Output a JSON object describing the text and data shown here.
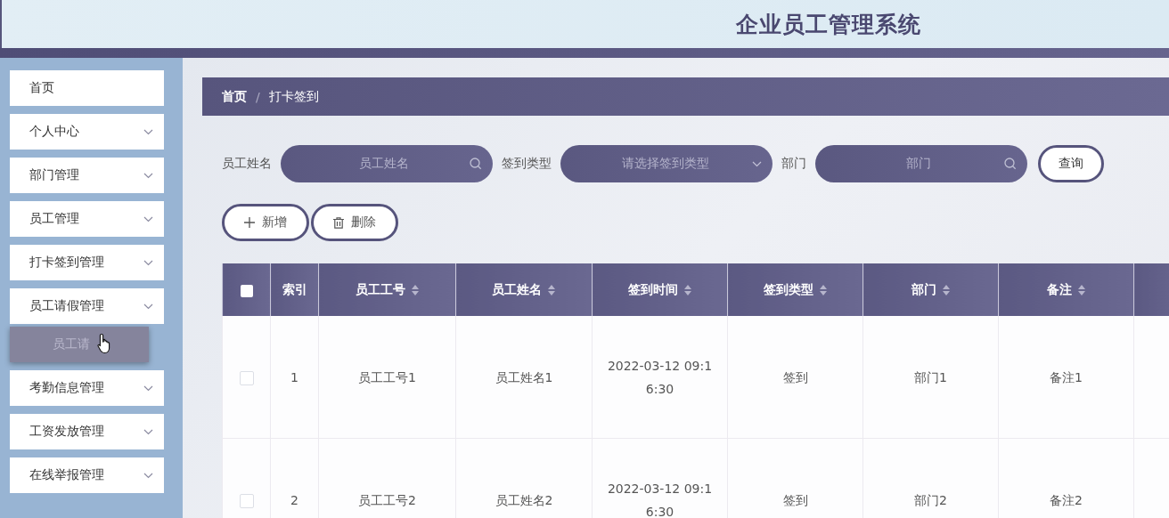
{
  "header": {
    "title": "企业员工管理系统"
  },
  "sidebar": {
    "items": [
      {
        "label": "首页",
        "expandable": false
      },
      {
        "label": "个人中心",
        "expandable": true
      },
      {
        "label": "部门管理",
        "expandable": true
      },
      {
        "label": "员工管理",
        "expandable": true
      },
      {
        "label": "打卡签到管理",
        "expandable": true
      },
      {
        "label": "员工请假管理",
        "expandable": true,
        "children": [
          {
            "label": "员工请",
            "hovered": true
          }
        ]
      },
      {
        "label": "考勤信息管理",
        "expandable": true
      },
      {
        "label": "工资发放管理",
        "expandable": true
      },
      {
        "label": "在线举报管理",
        "expandable": true
      }
    ]
  },
  "breadcrumb": {
    "items": [
      "首页",
      "打卡签到"
    ],
    "separator": "/"
  },
  "search": {
    "fields": [
      {
        "label": "员工姓名",
        "placeholder": "员工姓名",
        "kind": "search"
      },
      {
        "label": "签到类型",
        "placeholder": "请选择签到类型",
        "kind": "select"
      },
      {
        "label": "部门",
        "placeholder": "部门",
        "kind": "search"
      }
    ],
    "button": "查询"
  },
  "actions": [
    {
      "label": "新增",
      "kind": "add"
    },
    {
      "label": "删除",
      "kind": "delete"
    }
  ],
  "table": {
    "columns": [
      {
        "kind": "checkbox",
        "checked": false
      },
      {
        "kind": "text",
        "label": "索引",
        "sortable": false
      },
      {
        "kind": "text",
        "label": "员工工号",
        "sortable": true
      },
      {
        "kind": "text",
        "label": "员工姓名",
        "sortable": true
      },
      {
        "kind": "text",
        "label": "签到时间",
        "sortable": true
      },
      {
        "kind": "text",
        "label": "签到类型",
        "sortable": true
      },
      {
        "kind": "text",
        "label": "部门",
        "sortable": true
      },
      {
        "kind": "text",
        "label": "备注",
        "sortable": true
      },
      {
        "kind": "blank"
      }
    ],
    "rows": [
      {
        "checked": false,
        "cells": [
          "",
          "1",
          "员工工号1",
          "员工姓名1",
          "2022-03-12 09:16:30",
          "签到",
          "部门1",
          "备注1"
        ]
      },
      {
        "checked": false,
        "cells": [
          "",
          "2",
          "员工工号2",
          "员工姓名2",
          "2022-03-12 09:16:30",
          "签到",
          "部门2",
          "备注2"
        ]
      }
    ]
  }
}
